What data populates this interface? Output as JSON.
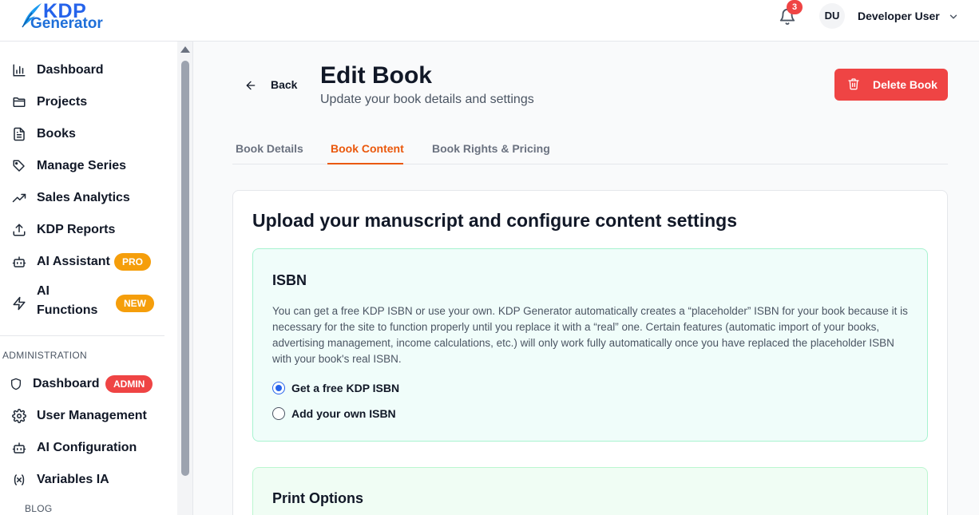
{
  "header": {
    "logo_top": "KDP",
    "logo_bottom": "Generator",
    "notification_count": "3",
    "user_initials": "DU",
    "user_name": "Developer User"
  },
  "sidebar": {
    "items": [
      {
        "label": "Dashboard",
        "icon": "bar-chart-icon"
      },
      {
        "label": "Projects",
        "icon": "folder-icon"
      },
      {
        "label": "Books",
        "icon": "document-icon"
      },
      {
        "label": "Manage Series",
        "icon": "tags-icon"
      },
      {
        "label": "Sales Analytics",
        "icon": "trending-up-icon"
      },
      {
        "label": "KDP Reports",
        "icon": "upload-icon"
      },
      {
        "label": "AI Assistant",
        "icon": "bot-icon",
        "badge": "PRO"
      },
      {
        "label_line1": "AI",
        "label_line2": "Functions",
        "icon": "zap-icon",
        "badge": "NEW"
      }
    ],
    "admin_section_label": "ADMINISTRATION",
    "admin_items": [
      {
        "label": "Dashboard",
        "icon": "shield-icon",
        "badge": "ADMIN"
      },
      {
        "label": "User Management",
        "icon": "gear-icon"
      },
      {
        "label": "AI Configuration",
        "icon": "bot-icon"
      },
      {
        "label": "Variables IA",
        "icon": "variable-icon"
      }
    ],
    "blog_section_label": "BLOG"
  },
  "main": {
    "back_label": "Back",
    "title": "Edit Book",
    "subtitle": "Update your book details and settings",
    "delete_label": "Delete Book",
    "tabs": [
      {
        "label": "Book Details",
        "active": false
      },
      {
        "label": "Book Content",
        "active": true
      },
      {
        "label": "Book Rights & Pricing",
        "active": false
      }
    ],
    "card_title": "Upload your manuscript and configure content settings",
    "isbn": {
      "title": "ISBN",
      "description": "You can get a free KDP ISBN or use your own. KDP Generator automatically creates a “placeholder” ISBN for your book because it is necessary for the site to function properly until you replace it with a “real” one. Certain features (automatic import of your books, advertising management, income calculations, etc.) will only work fully automatically once you have replaced the placeholder ISBN with your book's real ISBN.",
      "options": [
        {
          "label": "Get a free KDP ISBN",
          "selected": true
        },
        {
          "label": "Add your own ISBN",
          "selected": false
        }
      ]
    },
    "print_options_title": "Print Options"
  },
  "colors": {
    "accent": "#ea580c",
    "danger": "#ef4444",
    "badge_orange": "#f59e0b",
    "radio_selected": "#2563eb"
  }
}
